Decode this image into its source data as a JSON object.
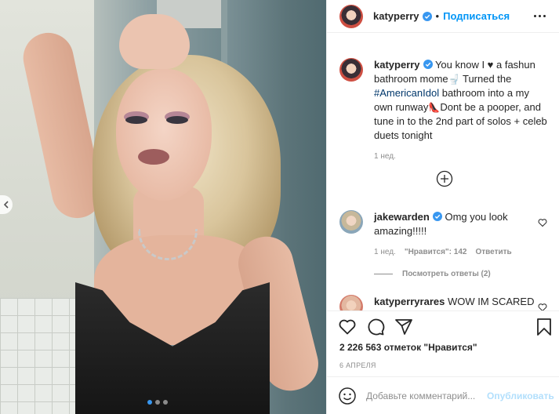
{
  "post": {
    "author": "katyperry",
    "follow_label": "Подписаться",
    "caption": {
      "text_before": "You know I ",
      "heart_glyph": "♥",
      "text_mid": " a fashun bathroom mome",
      "toilet_glyph": "🚽",
      "text_after_toilet": " Turned the ",
      "hashtag": "#AmericanIdol",
      "text_after_hashtag": " bathroom into a my own runway",
      "heel_glyph": "👠",
      "text_end": "Dont be a pooper, and tune in to the 2nd part of solos + celeb duets tonight",
      "time": "1 нед."
    },
    "comments": [
      {
        "author": "jakewarden",
        "text": "Omg you look amazing!!!!!",
        "time": "1 нед.",
        "likes": "\"Нравится\": 142",
        "reply_label": "Ответить",
        "view_replies": "Посмотреть ответы (2)"
      },
      {
        "author": "katyperryrares",
        "text": "WOW IM SCARED"
      }
    ],
    "likes_text": "2 226 563 отметок \"Нравится\"",
    "date": "6 АПРЕЛЯ",
    "comment_placeholder": "Добавьте комментарий...",
    "publish_label": "Опубликовать"
  },
  "carousel": {
    "total": 3,
    "active": 1
  },
  "icons": {
    "verified": "verified-badge-icon",
    "more": "more-options-icon",
    "heart": "heart-icon",
    "comment": "comment-icon",
    "share": "share-icon",
    "save": "bookmark-icon",
    "emoji": "emoji-icon",
    "load_more": "plus-circle-icon",
    "prev": "chevron-left-icon"
  },
  "colors": {
    "accent": "#0095f6",
    "link": "#00376b",
    "muted": "#8e8e8e",
    "publish_disabled": "#b2dffc"
  }
}
